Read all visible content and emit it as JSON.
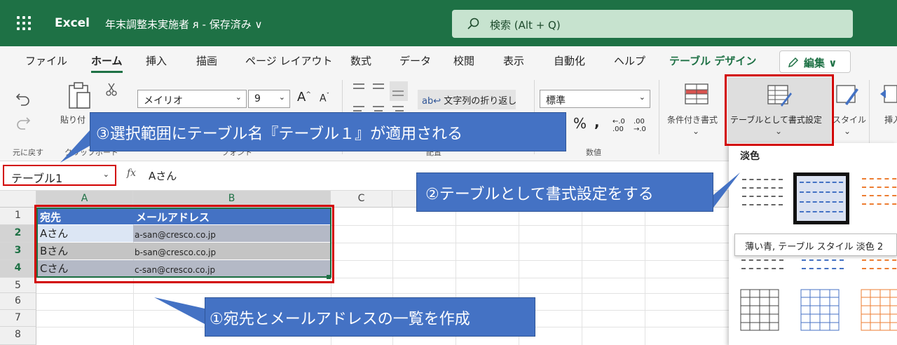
{
  "titlebar": {
    "app_name": "Excel",
    "doc_title": "年末調整未実施者 ᴙ - 保存済み ∨",
    "search_placeholder": "検索 (Alt + Q)",
    "bg_color": "#1e7145"
  },
  "tabs": [
    {
      "label": "ファイル"
    },
    {
      "label": "ホーム"
    },
    {
      "label": "挿入"
    },
    {
      "label": "描画"
    },
    {
      "label": "ページ レイアウト"
    },
    {
      "label": "数式"
    },
    {
      "label": "データ"
    },
    {
      "label": "校閲"
    },
    {
      "label": "表示"
    },
    {
      "label": "自動化"
    },
    {
      "label": "ヘルプ"
    },
    {
      "label": "テーブル デザイン"
    }
  ],
  "edit_button": "編集 ∨",
  "ribbon": {
    "undo_group_label": "元に戻す",
    "clipboard_label": "クリップボード",
    "paste_label": "貼り付",
    "font_name": "メイリオ",
    "font_size": "9",
    "font_group_label": "フォント",
    "wrap_text": "文字列の折り返し",
    "alignment_group_label": "配置",
    "number_format": "標準",
    "number_group_label": "数値",
    "conditional_format": "条件付き書式",
    "format_as_table": "テーブルとして書式設定",
    "cell_style": "スタイル",
    "insert": "挿入"
  },
  "formula_bar": {
    "name_box": "テーブル1",
    "fx": "fx",
    "value": "Aさん"
  },
  "grid": {
    "columns": [
      "A",
      "B",
      "C"
    ],
    "rows": [
      "1",
      "2",
      "3",
      "4",
      "5",
      "6",
      "7",
      "8"
    ],
    "table": {
      "headers": [
        "宛先",
        "メールアドレス"
      ],
      "rows": [
        [
          "Aさん",
          "a-san@cresco.co.jp"
        ],
        [
          "Bさん",
          "b-san@cresco.co.jp"
        ],
        [
          "Cさん",
          "c-san@cresco.co.jp"
        ]
      ]
    }
  },
  "gallery": {
    "title": "淡色",
    "tooltip": "薄い青, テーブル スタイル 淡色 2"
  },
  "callouts": {
    "c1": "①宛先とメールアドレスの一覧を作成",
    "c2": "②テーブルとして書式設定をする",
    "c3": "③選択範囲にテーブル名『テーブル１』が適用される"
  }
}
